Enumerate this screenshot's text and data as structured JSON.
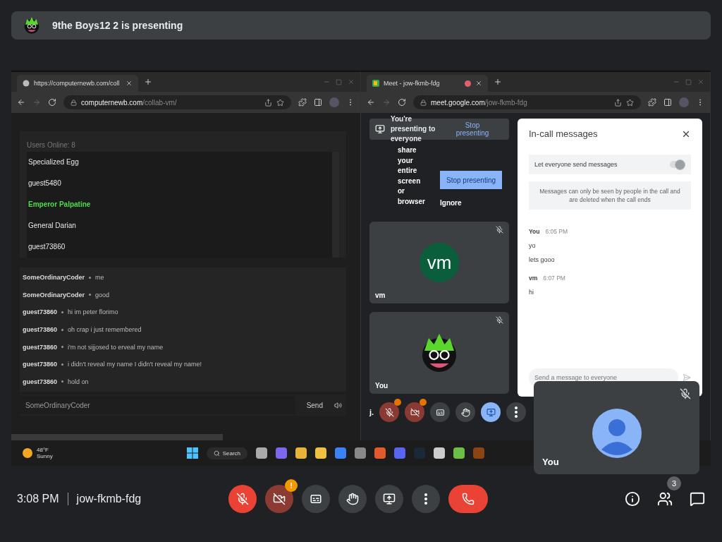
{
  "presenter_banner": {
    "text": "9the Boys12 2 is presenting"
  },
  "shared_screen": {
    "left_browser": {
      "tab_title": "https://computernewb.com/coll",
      "url_host": "computernewb.com",
      "url_path": "/collab-vm/",
      "users_heading": "Users Online: 8",
      "users": [
        {
          "name": "Specialized Egg",
          "highlighted": false
        },
        {
          "name": "guest5480",
          "highlighted": false
        },
        {
          "name": "Emperor Palpatine",
          "highlighted": true
        },
        {
          "name": "General Darian",
          "highlighted": false
        },
        {
          "name": "guest73860",
          "highlighted": false
        }
      ],
      "chat": [
        {
          "user": "SomeOrdinaryCoder",
          "message": "me"
        },
        {
          "user": "SomeOrdinaryCoder",
          "message": "good"
        },
        {
          "user": "guest73860",
          "message": "hi im peter florimo"
        },
        {
          "user": "guest73860",
          "message": "oh crap i just remembered"
        },
        {
          "user": "guest73860",
          "message": "i'm not sijjosed to erveal my name"
        },
        {
          "user": "guest73860",
          "message": "i didn't reveal my name I didn't reveal my name!"
        },
        {
          "user": "guest73860",
          "message": "hold on"
        }
      ],
      "chat_input": {
        "value": "SomeOrdinaryCoder"
      },
      "send_button": "Send"
    },
    "right_browser": {
      "tab_title": "Meet - jow-fkmb-fdg",
      "url_host": "meet.google.com",
      "url_path": "/jow-fkmb-fdg",
      "presenting_bar": {
        "text": "You're presenting to everyone",
        "button": "Stop presenting"
      },
      "share_warning": {
        "words": [
          "share",
          "your",
          "entire",
          "screen",
          "or",
          "browser"
        ],
        "stop_button": "Stop presenting",
        "ignore_button": "Ignore"
      },
      "tiles": [
        {
          "kind": "initials",
          "name": "vm",
          "initials": "vm",
          "muted": true
        },
        {
          "kind": "cartoon",
          "name": "You",
          "muted": true
        }
      ],
      "toolbar": {
        "label": "j.",
        "buttons": [
          {
            "kind": "mic",
            "selected": false
          },
          {
            "kind": "camera",
            "selected": false
          },
          {
            "kind": "captions",
            "selected": false
          },
          {
            "kind": "hand",
            "selected": false
          },
          {
            "kind": "present",
            "selected": true
          },
          {
            "kind": "more",
            "selected": false
          }
        ]
      },
      "chat_panel": {
        "title": "In-call messages",
        "toggle": {
          "label": "Let everyone send messages",
          "on": true
        },
        "notice": "Messages can only be seen by people in the call and are deleted when the call ends",
        "messages": [
          {
            "sender": "You",
            "time": "6:05 PM",
            "lines": [
              "yo",
              "lets gooo"
            ]
          },
          {
            "sender": "vm",
            "time": "6:07 PM",
            "lines": [
              "hi"
            ]
          }
        ],
        "input": {
          "placeholder": "Send a message to everyone"
        }
      }
    },
    "taskbar": {
      "temperature": "48°F",
      "weather": "Sunny",
      "search": "Search"
    }
  },
  "self_view": {
    "name": "You",
    "muted": true
  },
  "bottom_bar": {
    "time": "3:08 PM",
    "meeting_code": "jow-fkmb-fdg",
    "controls": [
      {
        "kind": "mic",
        "on": false
      },
      {
        "kind": "camera",
        "on": false,
        "badge": "!"
      },
      {
        "kind": "captions",
        "on": false
      },
      {
        "kind": "hand",
        "on": false
      },
      {
        "kind": "present",
        "on": false
      },
      {
        "kind": "more",
        "on": false
      },
      {
        "kind": "leave"
      }
    ],
    "people_count": "3"
  }
}
